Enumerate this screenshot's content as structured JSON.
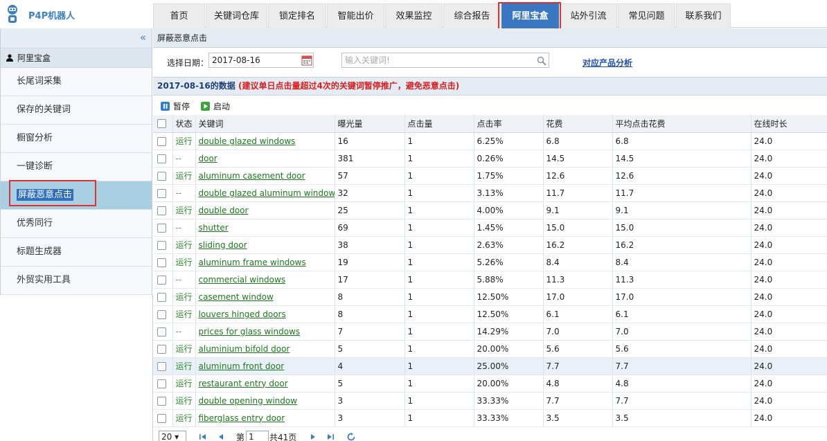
{
  "app": {
    "title": "P4P机器人"
  },
  "nav": {
    "tabs": [
      "首页",
      "关键词仓库",
      "锁定排名",
      "智能出价",
      "效果监控",
      "综合报告",
      "阿里宝盒",
      "站外引流",
      "常见问题",
      "联系我们"
    ],
    "active": "阿里宝盒"
  },
  "sidebar": {
    "collapse_icon": "«",
    "section": "阿里宝盒",
    "items": [
      "长尾词采集",
      "保存的关键词",
      "橱窗分析",
      "一键诊断",
      "屏蔽恶意点击",
      "优秀同行",
      "标题生成器",
      "外贸实用工具"
    ],
    "active": "屏蔽恶意点击"
  },
  "page": {
    "title": "屏蔽恶意点击"
  },
  "filter": {
    "date_label": "选择日期：",
    "date_value": "2017-08-16",
    "search_placeholder": "输入关键词!",
    "link": "对应产品分析"
  },
  "databar": {
    "date_title": "2017-08-16的数据",
    "warning": "(建议单日点击量超过4次的关键词暂停推广，避免恶意点击)"
  },
  "toolbar": {
    "pause": "暂停",
    "start": "启动"
  },
  "table": {
    "columns": [
      "状态",
      "关键词",
      "曝光量",
      "点击量",
      "点击率",
      "花费",
      "平均点击花费",
      "在线时长"
    ],
    "rows": [
      [
        "运行",
        "double glazed windows",
        "16",
        "1",
        "6.25%",
        "6.8",
        "6.8",
        "24.0"
      ],
      [
        "--",
        "door",
        "381",
        "1",
        "0.26%",
        "14.5",
        "14.5",
        "24.0"
      ],
      [
        "运行",
        "aluminum casement door",
        "57",
        "1",
        "1.75%",
        "12.6",
        "12.6",
        "24.0"
      ],
      [
        "--",
        "double glazed aluminum windows",
        "32",
        "1",
        "3.13%",
        "11.7",
        "11.7",
        "24.0"
      ],
      [
        "运行",
        "double door",
        "25",
        "1",
        "4.00%",
        "9.1",
        "9.1",
        "24.0"
      ],
      [
        "--",
        "shutter",
        "69",
        "1",
        "1.45%",
        "15.0",
        "15.0",
        "24.0"
      ],
      [
        "运行",
        "sliding door",
        "38",
        "1",
        "2.63%",
        "16.2",
        "16.2",
        "24.0"
      ],
      [
        "运行",
        "aluminum frame windows",
        "19",
        "1",
        "5.26%",
        "8.4",
        "8.4",
        "24.0"
      ],
      [
        "--",
        "commercial windows",
        "17",
        "1",
        "5.88%",
        "11.3",
        "11.3",
        "24.0"
      ],
      [
        "运行",
        "casement window",
        "8",
        "1",
        "12.50%",
        "17.0",
        "17.0",
        "24.0"
      ],
      [
        "运行",
        "louvers hinged doors",
        "8",
        "1",
        "12.50%",
        "6.1",
        "6.1",
        "24.0"
      ],
      [
        "--",
        "prices for glass windows",
        "7",
        "1",
        "14.29%",
        "7.0",
        "7.0",
        "24.0"
      ],
      [
        "运行",
        "aluminium bifold door",
        "5",
        "1",
        "20.00%",
        "5.6",
        "5.6",
        "24.0"
      ],
      [
        "运行",
        "aluminum front door",
        "4",
        "1",
        "25.00%",
        "7.7",
        "7.7",
        "24.0"
      ],
      [
        "运行",
        "restaurant entry door",
        "5",
        "1",
        "20.00%",
        "4.8",
        "4.8",
        "24.0"
      ],
      [
        "运行",
        "double opening window",
        "3",
        "1",
        "33.33%",
        "7.7",
        "7.7",
        "24.0"
      ],
      [
        "运行",
        "fiberglass entry door",
        "3",
        "1",
        "33.33%",
        "3.5",
        "3.5",
        "24.0"
      ]
    ],
    "highlight_row": 13
  },
  "pager": {
    "page_size": "20",
    "page_prefix": "第",
    "page_value": "1",
    "total": "共41页"
  },
  "colors": {
    "accent": "#3a77c3",
    "highlight": "#e03030",
    "keyword": "#1b7a1b"
  }
}
